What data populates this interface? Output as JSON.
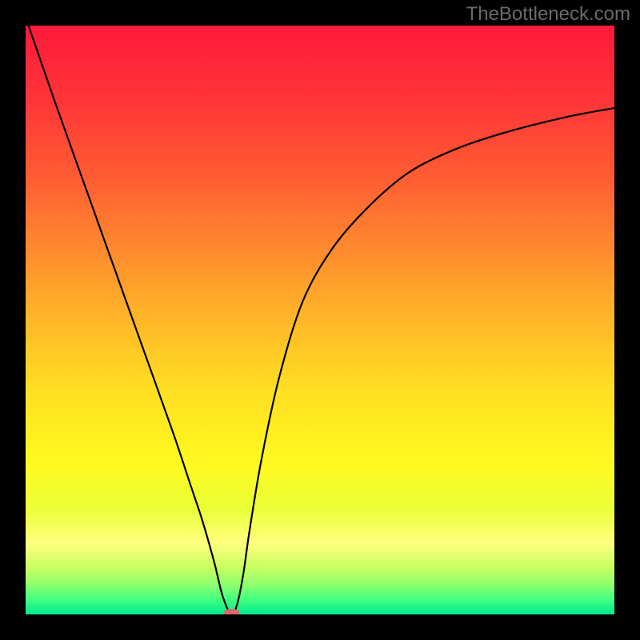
{
  "attribution": "TheBottleneck.com",
  "chart_data": {
    "type": "line",
    "title": "",
    "xlabel": "",
    "ylabel": "",
    "xlim": [
      0,
      100
    ],
    "ylim": [
      0,
      100
    ],
    "grid": false,
    "legend": false,
    "background_gradient": {
      "stops": [
        {
          "offset": 0.0,
          "color": "#ff1a3a"
        },
        {
          "offset": 0.12,
          "color": "#ff3338"
        },
        {
          "offset": 0.25,
          "color": "#ff5a33"
        },
        {
          "offset": 0.38,
          "color": "#ff8a2e"
        },
        {
          "offset": 0.5,
          "color": "#ffb728"
        },
        {
          "offset": 0.62,
          "color": "#ffdf22"
        },
        {
          "offset": 0.74,
          "color": "#fff91f"
        },
        {
          "offset": 0.82,
          "color": "#eaff36"
        },
        {
          "offset": 0.88,
          "color": "#ffff80"
        },
        {
          "offset": 0.92,
          "color": "#c8ff60"
        },
        {
          "offset": 0.95,
          "color": "#8dff70"
        },
        {
          "offset": 0.975,
          "color": "#40ff80"
        },
        {
          "offset": 1.0,
          "color": "#00e890"
        }
      ]
    },
    "series": [
      {
        "name": "bottleneck-curve",
        "color": "#000000",
        "x": [
          0.5,
          5,
          10,
          15,
          20,
          25,
          28,
          30,
          32,
          33.5,
          35,
          36,
          37,
          38,
          40,
          43,
          47,
          52,
          58,
          65,
          73,
          82,
          92,
          100
        ],
        "y": [
          100,
          87,
          73,
          59,
          45,
          31,
          22,
          16,
          9,
          3,
          0,
          2,
          7,
          14,
          26,
          40,
          53,
          62,
          69,
          75,
          79,
          82,
          84.5,
          86
        ]
      }
    ],
    "marker": {
      "name": "optimal-point",
      "x": 35,
      "y": 0,
      "color": "#d66b6b",
      "rx": 10,
      "ry": 5
    }
  }
}
